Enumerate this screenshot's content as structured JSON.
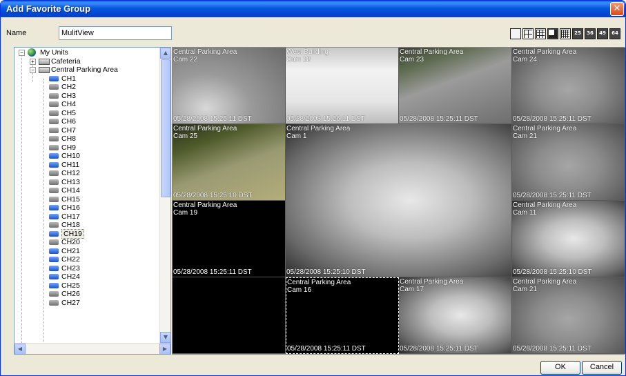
{
  "window": {
    "title": "Add Favorite Group",
    "close_glyph": "✕"
  },
  "name_label": "Name",
  "name_value": "MulitView",
  "layout_buttons": [
    {
      "label": "",
      "icon": "layout-1x1-icon"
    },
    {
      "label": "",
      "icon": "layout-2x2-icon"
    },
    {
      "label": "",
      "icon": "layout-3x3-icon"
    },
    {
      "label": "",
      "icon": "layout-1plus5-icon"
    },
    {
      "label": "",
      "icon": "layout-4x4-icon"
    },
    {
      "label": "25",
      "icon": "layout-25-icon"
    },
    {
      "label": "36",
      "icon": "layout-36-icon"
    },
    {
      "label": "49",
      "icon": "layout-49-icon"
    },
    {
      "label": "64",
      "icon": "layout-64-icon"
    }
  ],
  "tree": {
    "root": "My Units",
    "units": [
      "Cafeteria",
      "Central Parking Area"
    ],
    "channels": [
      "CH1",
      "CH2",
      "CH3",
      "CH4",
      "CH5",
      "CH6",
      "CH7",
      "CH8",
      "CH9",
      "CH10",
      "CH11",
      "CH12",
      "CH13",
      "CH14",
      "CH15",
      "CH16",
      "CH17",
      "CH18",
      "CH19",
      "CH20",
      "CH21",
      "CH22",
      "CH23",
      "CH24",
      "CH25",
      "CH26",
      "CH27"
    ],
    "selected_channel": "CH19",
    "expand_glyphs": {
      "plus": "+",
      "minus": "−"
    },
    "scroll_glyphs": {
      "up": "▲",
      "down": "▼",
      "left": "◀",
      "right": "▶"
    }
  },
  "cells": [
    {
      "title": "Central Parking Area",
      "cam": "Cam 22",
      "stamp": "05/28/2008 15:25:11 DST",
      "scene": "parking-grey"
    },
    {
      "title": "West Building",
      "cam": "Cam 18",
      "stamp": "05/28/2008 15:26:11 DST",
      "scene": "indoor-white"
    },
    {
      "title": "Central Parking Area",
      "cam": "Cam 23",
      "stamp": "05/28/2008 15:25:11 DST",
      "scene": "parking-wide"
    },
    {
      "title": "Central Parking Area",
      "cam": "Cam 24",
      "stamp": "05/28/2008 15:25:11 DST",
      "scene": "parking-cars"
    },
    {
      "title": "Central Parking Area",
      "cam": "Cam 25",
      "stamp": "05/28/2008 15:25:10 DST",
      "scene": "parking-green"
    },
    {
      "title": "Central Parking Area",
      "cam": "Cam 1",
      "stamp": "05/28/2008 15:25:10 DST",
      "scene": "indoor-door"
    },
    {
      "title": "Central Parking Area",
      "cam": "Cam 21",
      "stamp": "05/28/2008 15:25:11 DST",
      "scene": "parking-cars"
    },
    {
      "title": "Central Parking Area",
      "cam": "Cam 19",
      "stamp": "05/28/2008 15:25:11 DST",
      "scene": "black"
    },
    {
      "title": "Central Parking Area",
      "cam": "Cam 11",
      "stamp": "05/28/2008 15:25:10 DST",
      "scene": "indoor-door"
    },
    {
      "title": "",
      "cam": "",
      "stamp": "",
      "scene": "black"
    },
    {
      "title": "Central Parking Area",
      "cam": "Cam 16",
      "stamp": "05/28/2008 15:25:11 DST",
      "scene": "black",
      "selected": true
    },
    {
      "title": "Central Parking Area",
      "cam": "Cam 17",
      "stamp": "05/28/2008 15:25:11 DST",
      "scene": "indoor-door"
    },
    {
      "title": "Central Parking Area",
      "cam": "Cam 21",
      "stamp": "05/28/2008 15:25:11 DST",
      "scene": "parking-cars"
    }
  ],
  "buttons": {
    "ok": "OK",
    "cancel": "Cancel"
  }
}
